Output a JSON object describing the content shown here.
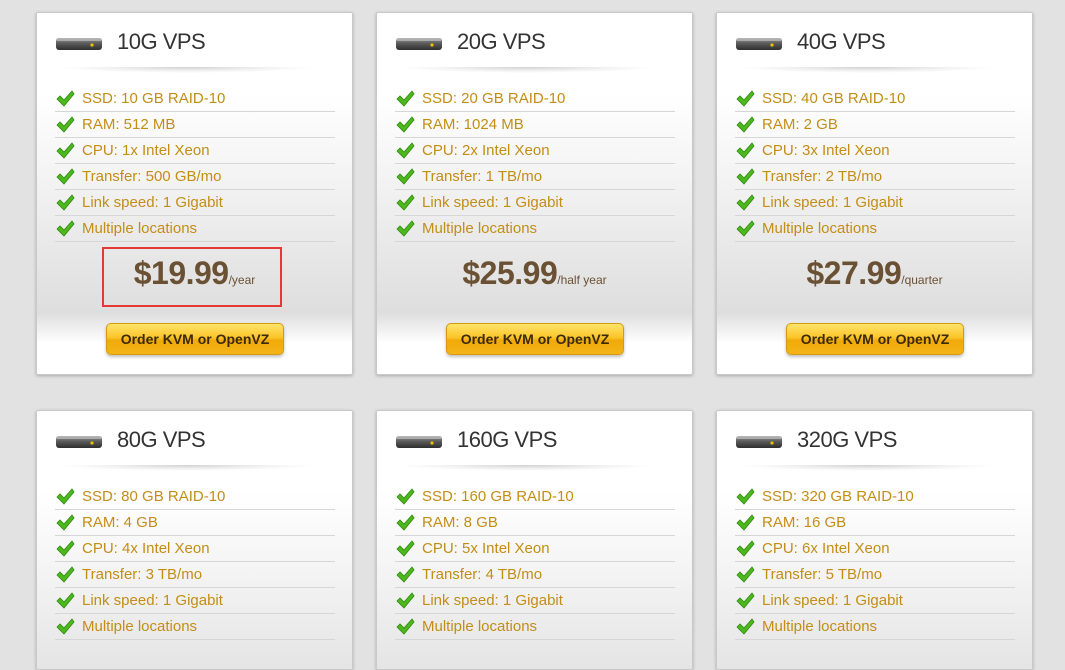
{
  "plans": [
    {
      "title": "10G VPS",
      "features": [
        "SSD: 10 GB RAID-10",
        "RAM: 512 MB",
        "CPU: 1x Intel Xeon",
        "Transfer: 500 GB/mo",
        "Link speed: 1 Gigabit",
        "Multiple locations"
      ],
      "price": "$19.99",
      "period": "/year",
      "button": "Order KVM or OpenVZ",
      "highlighted": true
    },
    {
      "title": "20G VPS",
      "features": [
        "SSD: 20 GB RAID-10",
        "RAM: 1024 MB",
        "CPU: 2x Intel Xeon",
        "Transfer: 1 TB/mo",
        "Link speed: 1 Gigabit",
        "Multiple locations"
      ],
      "price": "$25.99",
      "period": "/half year",
      "button": "Order KVM or OpenVZ"
    },
    {
      "title": "40G VPS",
      "features": [
        "SSD: 40 GB RAID-10",
        "RAM: 2 GB",
        "CPU: 3x Intel Xeon",
        "Transfer: 2 TB/mo",
        "Link speed: 1 Gigabit",
        "Multiple locations"
      ],
      "price": "$27.99",
      "period": "/quarter",
      "button": "Order KVM or OpenVZ"
    },
    {
      "title": "80G VPS",
      "features": [
        "SSD: 80 GB RAID-10",
        "RAM: 4 GB",
        "CPU: 4x Intel Xeon",
        "Transfer: 3 TB/mo",
        "Link speed: 1 Gigabit",
        "Multiple locations"
      ]
    },
    {
      "title": "160G VPS",
      "features": [
        "SSD: 160 GB RAID-10",
        "RAM: 8 GB",
        "CPU: 5x Intel Xeon",
        "Transfer: 4 TB/mo",
        "Link speed: 1 Gigabit",
        "Multiple locations"
      ]
    },
    {
      "title": "320G VPS",
      "features": [
        "SSD: 320 GB RAID-10",
        "RAM: 16 GB",
        "CPU: 6x Intel Xeon",
        "Transfer: 5 TB/mo",
        "Link speed: 1 Gigabit",
        "Multiple locations"
      ]
    }
  ],
  "icons": {
    "server": "server-icon",
    "check": "check-icon"
  },
  "colors": {
    "feature_text": "#c38d16",
    "price_text": "#6b5134",
    "button_gold": "#fbc52a",
    "highlight": "#e53935"
  }
}
